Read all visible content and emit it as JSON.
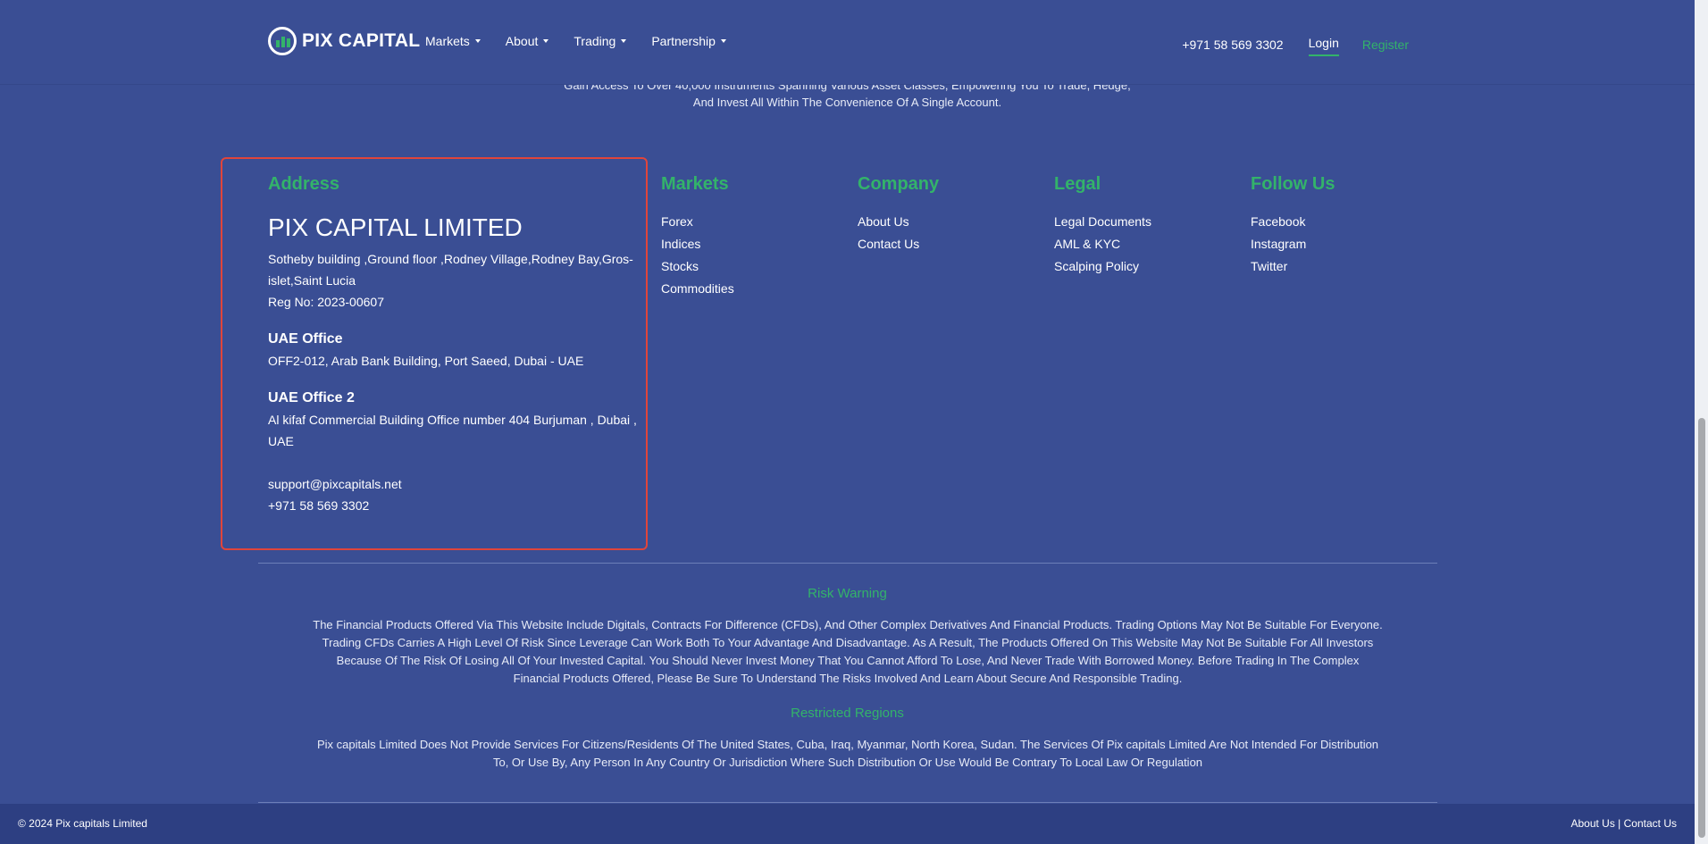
{
  "nav": {
    "logo_text": "PIX CAPITAL",
    "menu": [
      "Markets",
      "About",
      "Trading",
      "Partnership"
    ],
    "phone": "+971 58 569 3302",
    "login": "Login",
    "register": "Register"
  },
  "intro": {
    "line1": "Gain Access To Over 40,000 Instruments Spanning Various Asset Classes, Empowering You To Trade, Hedge,",
    "line2": "And Invest All Within The Convenience Of A Single Account."
  },
  "footer": {
    "address": {
      "heading": "Address",
      "company": "PIX CAPITAL LIMITED",
      "line1": "Sotheby building ,Ground floor ,Rodney Village,Rodney Bay,Gros-islet,Saint Lucia",
      "reg": "Reg No: 2023-00607",
      "office1_title": "UAE Office",
      "office1_addr": "OFF2-012, Arab Bank Building, Port Saeed, Dubai - UAE",
      "office2_title": "UAE Office 2",
      "office2_addr": "Al kifaf Commercial Building Office number 404 Burjuman , Dubai , UAE",
      "email": "support@pixcapitals.net",
      "phone": "+971 58 569 3302"
    },
    "markets": {
      "heading": "Markets",
      "items": [
        "Forex",
        "Indices",
        "Stocks",
        "Commodities"
      ]
    },
    "company": {
      "heading": "Company",
      "items": [
        "About Us",
        "Contact Us"
      ]
    },
    "legal": {
      "heading": "Legal",
      "items": [
        "Legal Documents",
        "AML & KYC",
        "Scalping Policy"
      ]
    },
    "follow": {
      "heading": "Follow Us",
      "items": [
        "Facebook",
        "Instagram",
        "Twitter"
      ]
    }
  },
  "risk": {
    "title": "Risk Warning",
    "text": "The Financial Products Offered Via This Website Include Digitals, Contracts For Difference (CFDs), And Other Complex Derivatives And Financial Products. Trading Options May Not Be Suitable For Everyone. Trading CFDs Carries A High Level Of Risk Since Leverage Can Work Both To Your Advantage And Disadvantage. As A Result, The Products Offered On This Website May Not Be Suitable For All Investors Because Of The Risk Of Losing All Of Your Invested Capital. You Should Never Invest Money That You Cannot Afford To Lose, And Never Trade With Borrowed Money. Before Trading In The Complex Financial Products Offered, Please Be Sure To Understand The Risks Involved And Learn About Secure And Responsible Trading."
  },
  "regions": {
    "title": "Restricted Regions",
    "text": "Pix capitals Limited Does Not Provide Services For Citizens/Residents Of The United States, Cuba, Iraq, Myanmar, North Korea, Sudan. The Services Of Pix capitals Limited Are Not Intended For Distribution To, Or Use By, Any Person In Any Country Or Jurisdiction Where Such Distribution Or Use Would Be Contrary To Local Law Or Regulation"
  },
  "bottom": {
    "copyright": "© 2024 Pix capitals Limited",
    "about": "About Us",
    "separator": "|",
    "contact": "Contact Us"
  },
  "colors": {
    "background": "#3a4e94",
    "accent": "#33b36a",
    "highlight": "#e0453b",
    "bottom_bar": "#2d3f82"
  }
}
